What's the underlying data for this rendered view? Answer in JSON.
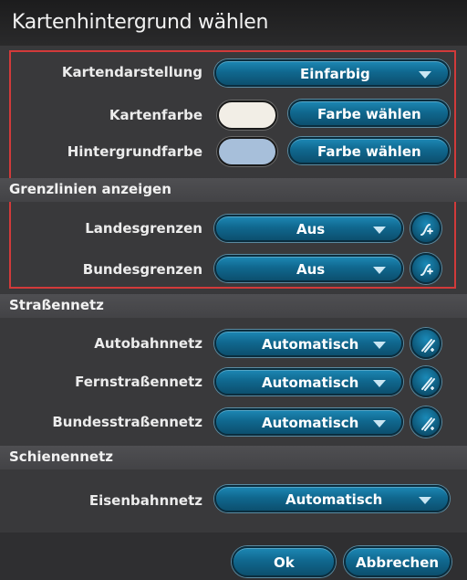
{
  "dialog": {
    "title": "Kartenhintergrund wählen"
  },
  "map_display": {
    "label": "Kartendarstellung",
    "value": "Einfarbig",
    "card_color_label": "Kartenfarbe",
    "card_color_value": "#f2eee6",
    "card_color_button": "Farbe wählen",
    "background_color_label": "Hintergrundfarbe",
    "background_color_value": "#a7bfda",
    "background_color_button": "Farbe wählen"
  },
  "borders": {
    "section_title": "Grenzlinien anzeigen",
    "country_label": "Landesgrenzen",
    "country_value": "Aus",
    "state_label": "Bundesgrenzen",
    "state_value": "Aus"
  },
  "roads": {
    "section_title": "Straßennetz",
    "motorway_label": "Autobahnnetz",
    "motorway_value": "Automatisch",
    "highway_label": "Fernstraßennetz",
    "highway_value": "Automatisch",
    "federal_road_label": "Bundesstraßennetz",
    "federal_road_value": "Automatisch"
  },
  "rail": {
    "section_title": "Schienennetz",
    "railway_label": "Eisenbahnnetz",
    "railway_value": "Automatisch"
  },
  "footer": {
    "ok_label": "Ok",
    "cancel_label": "Abbrechen"
  },
  "icons": {
    "line_style": "line-style-icon",
    "dropdown": "chevron-down-icon"
  }
}
